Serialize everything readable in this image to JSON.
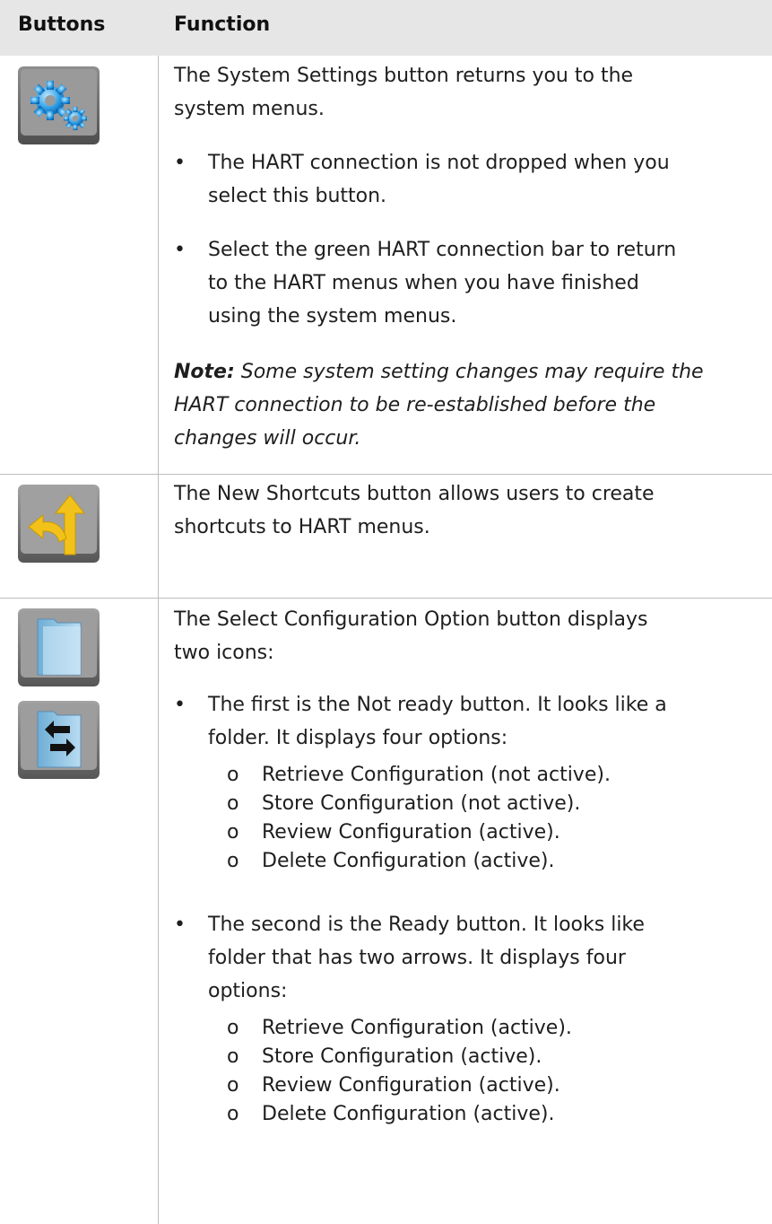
{
  "header": {
    "col1": "Buttons",
    "col2": "Function"
  },
  "rows": [
    {
      "icon": "gear-icon",
      "desc": [
        "The System Settings button returns you to the",
        "system menus."
      ],
      "bullets": [
        [
          "The HART connection is not dropped when you",
          "select this button."
        ],
        [
          "Select the green HART connection bar to return",
          "to the HART menus when you have finished",
          "using the system menus."
        ]
      ],
      "note_label": "Note:",
      "note_lines": [
        " Some system setting changes may require the",
        "HART connection to be re-established before the",
        "changes will occur."
      ]
    },
    {
      "icon": "shortcut-arrows-icon",
      "desc": [
        "The New Shortcuts button allows users to create",
        "shortcuts to HART menus."
      ]
    },
    {
      "icons": [
        "folder-icon",
        "folder-arrows-icon"
      ],
      "desc": [
        "The Select Configuration Option button displays",
        "two icons:"
      ],
      "bullets": [
        {
          "lines": [
            "The first is the Not ready button. It looks like a",
            "folder. It displays four options:"
          ],
          "options": [
            "Retrieve Configuration (not active).",
            "Store Configuration (not active).",
            "Review Configuration (active).",
            "Delete Configuration (active)."
          ]
        },
        {
          "lines": [
            "The second is the Ready button. It looks like",
            "folder that has two arrows. It displays four",
            "options:"
          ],
          "options": [
            "Retrieve Configuration (active).",
            "Store Configuration (active).",
            "Review Configuration (active).",
            "Delete Configuration (active)."
          ]
        }
      ]
    }
  ],
  "bullet_char": "•",
  "sub_bullet_char": "o"
}
